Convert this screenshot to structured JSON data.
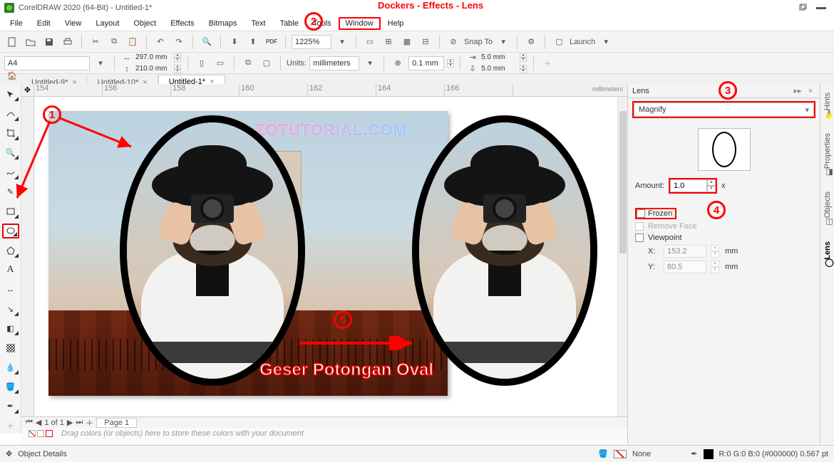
{
  "app": {
    "title": "CorelDRAW 2020 (64-Bit) - Untitled-1*"
  },
  "annotation": {
    "top_hint": "Dockers - Effects - Lens",
    "step5_label": "Geser Potongan Oval",
    "watermark": "ZOTUTORIAL.COM"
  },
  "menu": {
    "file": "File",
    "edit": "Edit",
    "view": "View",
    "layout": "Layout",
    "object": "Object",
    "effects": "Effects",
    "bitmaps": "Bitmaps",
    "text": "Text",
    "table": "Table",
    "tools": "Tools",
    "window": "Window",
    "help": "Help"
  },
  "toolbar1": {
    "zoom": "1225%",
    "snapto": "Snap To",
    "launch": "Launch"
  },
  "toolbar2": {
    "page_preset": "A4",
    "page_w": "297.0 mm",
    "page_h": "210.0 mm",
    "units_label": "Units:",
    "units_value": "millimeters",
    "nudge": "0.1 mm",
    "dup_x": "5.0 mm",
    "dup_y": "5.0 mm"
  },
  "doc_tabs": [
    {
      "label": "Untitled-9*"
    },
    {
      "label": "Untitled-10*"
    },
    {
      "label": "Untitled-1*",
      "active": true
    }
  ],
  "ruler": {
    "ticks": [
      "154",
      "156",
      "158",
      "160",
      "162",
      "164",
      "166"
    ],
    "unit": "millimeters"
  },
  "page_nav": {
    "range": "1 of 1",
    "page_tab": "Page 1"
  },
  "color_dock_hint": "Drag colors (or objects) here to store these colors with your document",
  "statusbar": {
    "cursor_section": "Object Details",
    "fill": "None",
    "outline_text": "R:0 G:0 B:0 (#000000)  0.567 pt"
  },
  "lens": {
    "title": "Lens",
    "type": "Magnify",
    "amount_label": "Amount:",
    "amount_value": "1.0",
    "amount_suffix": "x",
    "frozen": "Frozen",
    "remove_face": "Remove Face",
    "viewpoint": "Viewpoint",
    "x_label": "X:",
    "x_value": "153.2",
    "y_label": "Y:",
    "y_value": "80.5",
    "unit": "mm"
  },
  "vtabs": {
    "hints": "Hints",
    "properties": "Properties",
    "objects": "Objects",
    "lens": "Lens"
  }
}
